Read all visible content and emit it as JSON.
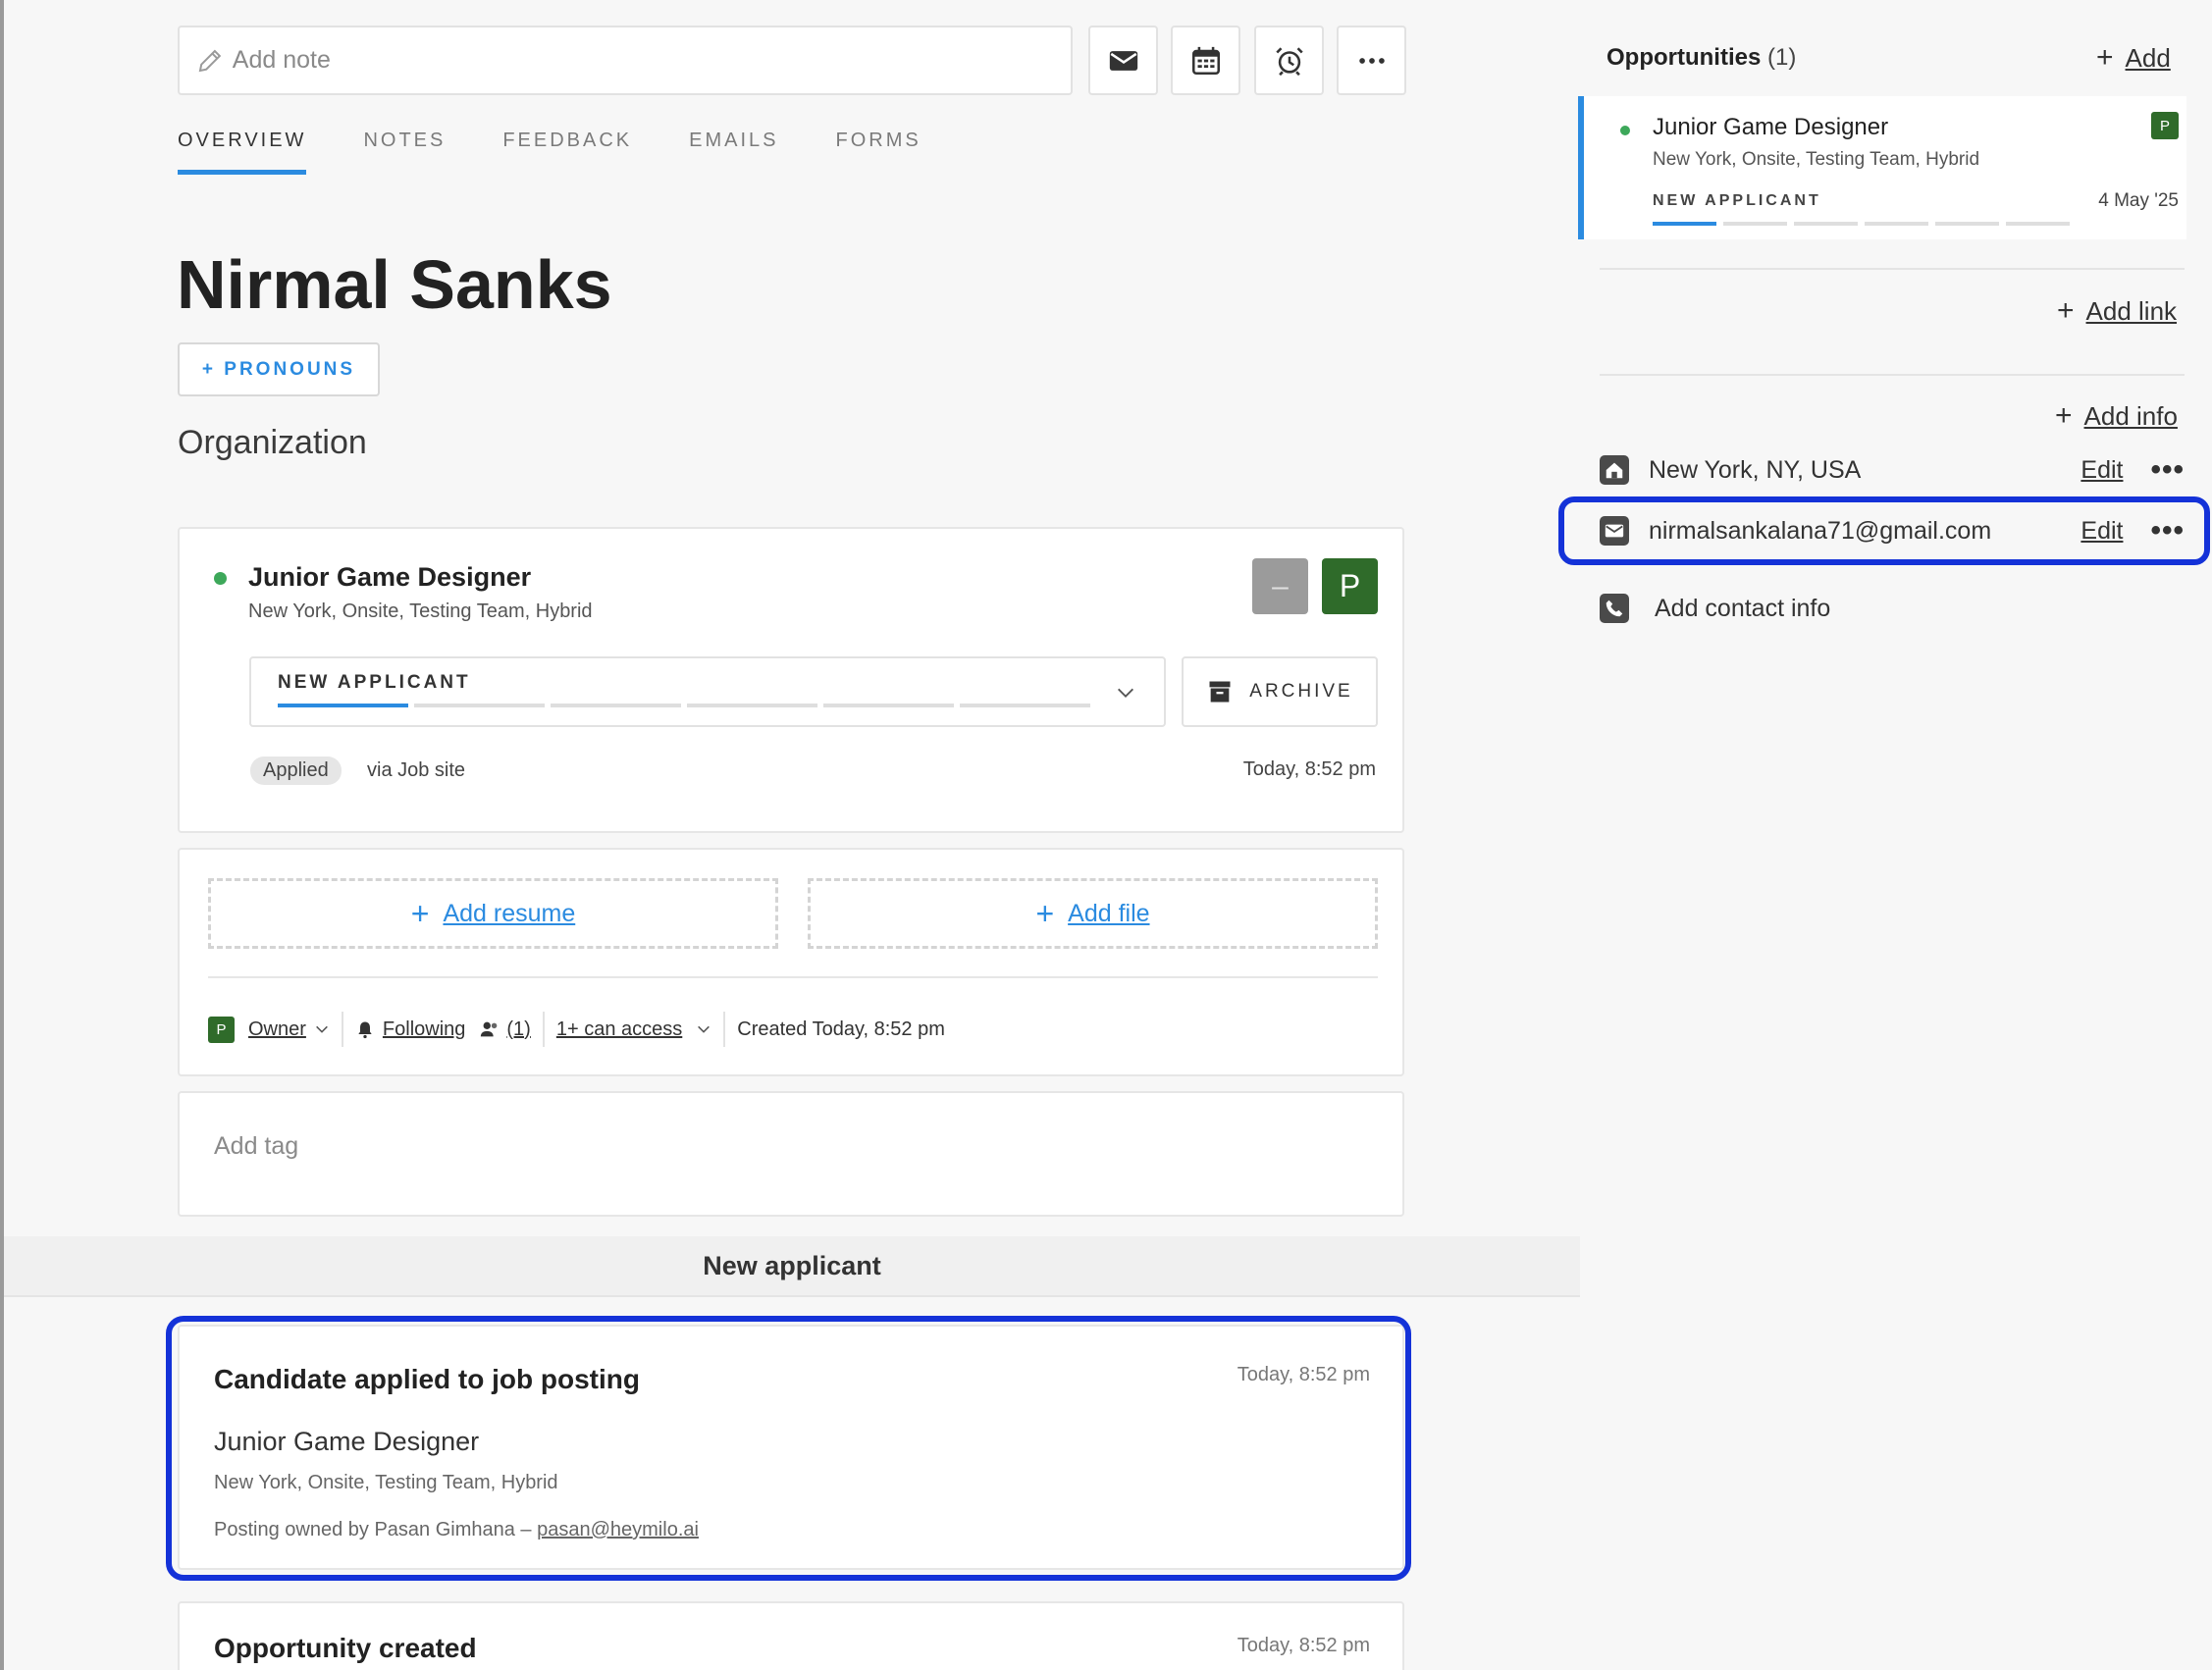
{
  "toolbar": {
    "note_placeholder": "Add note",
    "buttons": [
      "email",
      "calendar",
      "alarm",
      "more"
    ]
  },
  "tabs": [
    {
      "label": "OVERVIEW",
      "active": true
    },
    {
      "label": "NOTES",
      "active": false
    },
    {
      "label": "FEEDBACK",
      "active": false
    },
    {
      "label": "EMAILS",
      "active": false
    },
    {
      "label": "FORMS",
      "active": false
    }
  ],
  "candidate": {
    "name": "Nirmal Sanks",
    "pronouns_label": "+ PRONOUNS",
    "organization_label": "Organization"
  },
  "job": {
    "title": "Junior Game Designer",
    "details": "New York, Onsite, Testing Team, Hybrid",
    "owner_initial": "P",
    "stage": "NEW APPLICANT",
    "stage_progress": "1 of 6",
    "archive_label": "ARCHIVE",
    "applied_badge": "Applied",
    "source": "via Job site",
    "applied_time": "Today, 8:52 pm"
  },
  "files": {
    "add_resume": "Add resume",
    "add_file": "Add file"
  },
  "meta": {
    "owner_initial": "P",
    "owner_label": "Owner",
    "following_label": "Following",
    "followers_count": "(1)",
    "access_label": "1+ can access",
    "created_label": "Created Today, 8:52 pm"
  },
  "tags": {
    "placeholder": "Add tag"
  },
  "timeline": {
    "stage_header": "New applicant",
    "events": [
      {
        "title": "Candidate applied to job posting",
        "time": "Today, 8:52 pm",
        "job_title": "Junior Game Designer",
        "job_details": "New York, Onsite, Testing Team, Hybrid",
        "owner_prefix": "Posting owned by Pasan Gimhana –",
        "owner_email": "pasan@heymilo.ai"
      },
      {
        "title": "Opportunity created",
        "time": "Today, 8:52 pm"
      }
    ]
  },
  "sidebar": {
    "opportunities_title": "Opportunities",
    "opportunities_count": "(1)",
    "add_label": "Add",
    "opportunity": {
      "title": "Junior Game Designer",
      "details": "New York, Onsite, Testing Team, Hybrid",
      "stage": "NEW APPLICANT",
      "date": "4 May '25",
      "owner_initial": "P"
    },
    "add_link_label": "Add link",
    "add_info_label": "Add info",
    "location": "New York, NY, USA",
    "email": "nirmalsankalana71@gmail.com",
    "edit_label": "Edit",
    "add_contact_label": "Add contact info"
  },
  "colors": {
    "accent": "#2b8be0",
    "owner_green": "#2f6b2a",
    "status_dot": "#3da85a",
    "highlight": "#1432d8"
  }
}
